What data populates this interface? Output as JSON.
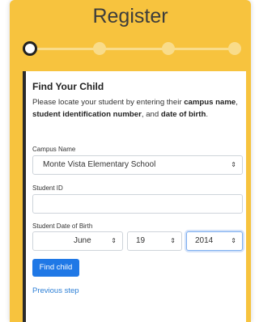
{
  "title": "Register",
  "stepper": {
    "total": 4,
    "current": 1
  },
  "card": {
    "heading": "Find Your Child",
    "intro_1": "Please locate your student by entering their ",
    "intro_bold_1": "campus name",
    "intro_2": ", ",
    "intro_bold_2": "student identification number",
    "intro_3": ", and ",
    "intro_bold_3": "date of birth",
    "intro_4": ".",
    "campus_label": "Campus Name",
    "campus_value": "Monte Vista Elementary School",
    "student_id_label": "Student ID",
    "student_id_value": "",
    "dob_label": "Student Date of Birth",
    "dob_month": "June",
    "dob_day": "19",
    "dob_year": "2014",
    "find_button": "Find child",
    "previous_link": "Previous step"
  },
  "colors": {
    "frame": "#f7c33e",
    "accent": "#1f78e6",
    "link": "#2d7fd6"
  }
}
